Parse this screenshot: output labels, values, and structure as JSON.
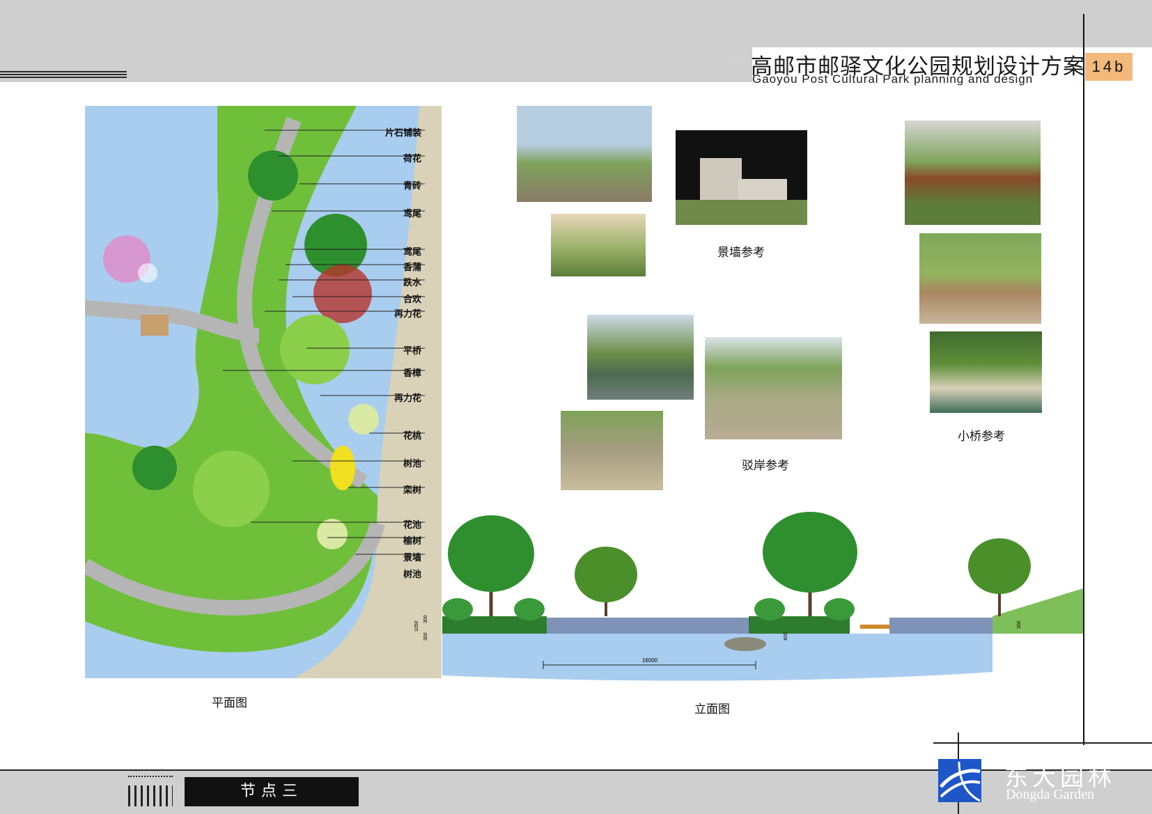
{
  "header": {
    "title_cn": "高邮市邮驿文化公园规划设计方案",
    "title_en": "Gaoyou Post Cultural Park planning and design",
    "page_number": "14b"
  },
  "plan": {
    "caption": "平面图",
    "callouts": [
      "片石铺装",
      "荷花",
      "青砖",
      "鸢尾",
      "鸢尾",
      "香蒲",
      "跌水",
      "合欢",
      "再力花",
      "平桥",
      "香樟",
      "再力花",
      "花桃",
      "树池",
      "栾树",
      "花池",
      "榆树",
      "景墙",
      "树池"
    ]
  },
  "references": {
    "wall_caption": "景墙参考",
    "bank_caption": "驳岸参考",
    "bridge_caption": "小桥参考"
  },
  "elevation": {
    "caption": "立面图",
    "dimension": "16000",
    "heights": [
      "300",
      "1050",
      "300",
      "400",
      "300"
    ]
  },
  "footer": {
    "node_label": "节点三",
    "brand_cn": "东大园林",
    "brand_en": "Dongda Garden"
  },
  "colors": {
    "header_band": "#cfcfcf",
    "page_tab": "#f2b97a",
    "water": "#a9cdef",
    "lawn": "#6fbf3a",
    "path": "#d9d2b8"
  }
}
